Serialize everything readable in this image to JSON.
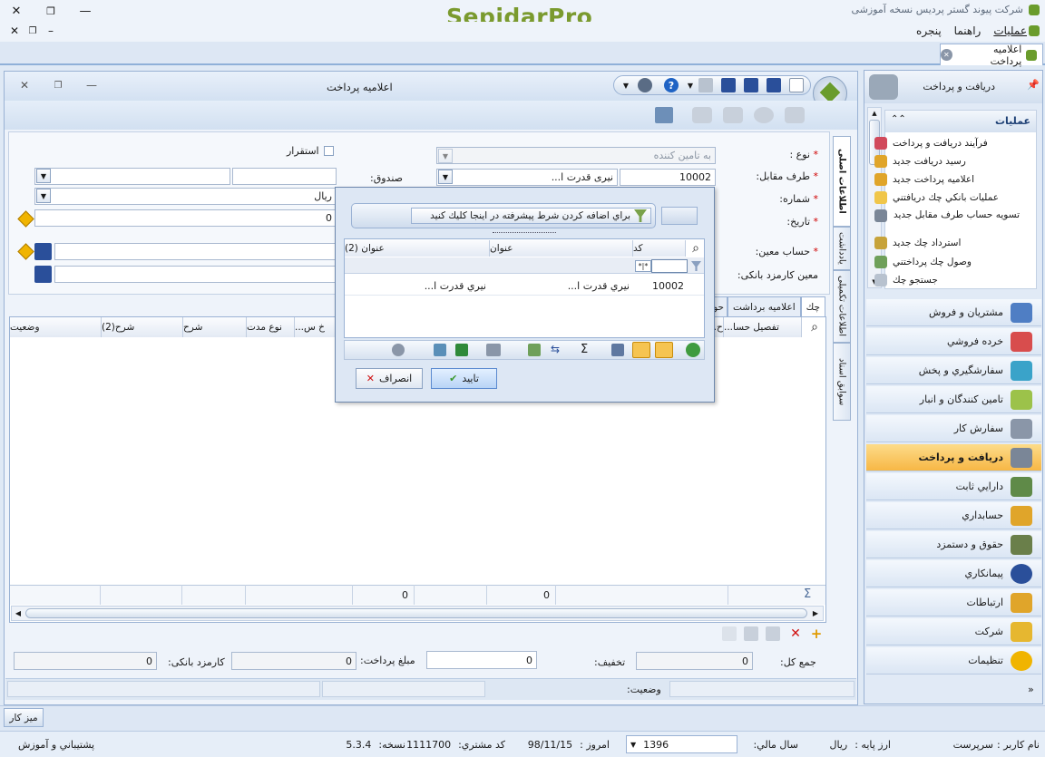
{
  "app": {
    "logo_text": "SepidarPro",
    "company_title": "شرکت پیوند گستر پردیس نسخه آموزشی",
    "menu": [
      "عملیات",
      "راهنما",
      "پنجره"
    ],
    "doc_tab": "اعلامیه پرداخت"
  },
  "window": {
    "title": "اعلامیه پرداخت"
  },
  "form": {
    "type_label": "نوع :",
    "type_value": "به تامین کننده",
    "party_label": "طرف مقابل:",
    "party_code": "10002",
    "party_name": "نیری قدرت ا...",
    "number_label": "شماره:",
    "date_label": "تاریخ:",
    "account_label": "حساب معین:",
    "bankfee_account_label": "معین کارمزد بانکی:",
    "fund_label": "صندوق:",
    "settle_label": "استقرار",
    "currency_value": "ریال",
    "amount_value": "0"
  },
  "tabs": [
    "چك",
    "اعلامیه برداشت",
    "حواله"
  ],
  "vtabs": [
    "اطلاعات اصلی",
    "یادداشت",
    "اطلاعات تکمیلی",
    "سوابق اسناد"
  ],
  "grid": {
    "headers": [
      "تفصیل حسا...",
      "ح...",
      "خ س...",
      "نوع مدت",
      "شرح",
      "شرح(2)",
      "وضعیت"
    ],
    "sums": [
      "0",
      "0"
    ]
  },
  "footer": {
    "total_label": "جمع کل:",
    "total_value": "0",
    "discount_label": "تخفیف:",
    "payment_label": "مبلغ پرداخت:",
    "payment_value": "0",
    "payment_extra": "0",
    "bankfee_label": "کارمزد بانکی:",
    "bankfee_value": "0",
    "left_value": "0",
    "status_label": "وضعیت:"
  },
  "popup": {
    "filter_prompt": "براي اضافه كردن شرط پيشرفته در اينجا كليك كنيد",
    "col_code": "کد",
    "col_title": "عنوان",
    "col_title2": "عنوان (2)",
    "filter_token": "*|*",
    "row_code": "10002",
    "row_title": "نیري قدرت ا...",
    "row_title2": "نیري قدرت ا...",
    "ok_label": "تاييد",
    "cancel_label": "انصراف"
  },
  "sidebar": {
    "header": "دريافت و پرداخت",
    "ops_title": "عمليات",
    "ops": [
      "فرآيند دريافت و پرداخت",
      "رسيد دريافت جديد",
      "اعلاميه پرداخت جديد",
      "عمليات بانكي چك دريافتني",
      "تسويه حساب طرف مقابل جديد",
      "استرداد چك جديد",
      "وصول چك پرداختني",
      "جستجو چك"
    ],
    "modules": [
      "مشتريان و فروش",
      "خرده فروشي",
      "سفارشگيري و پخش",
      "تامين كنندگان و انبار",
      "سفارش كار",
      "دريافت و پرداخت",
      "دارايي ثابت",
      "حسابداري",
      "حقوق و دستمزد",
      "پيمانكاري",
      "ارتباطات",
      "شركت",
      "تنظيمات"
    ],
    "active_module": "دريافت و پرداخت"
  },
  "taskbar": {
    "desk_label": "ميز كار"
  },
  "statusbar": {
    "user_label": "نام کاربر :",
    "user_value": "سرپرست",
    "base_currency_label": "ارز پايه :",
    "base_currency_value": "ريال",
    "fiscal_year_label": "سال مالي:",
    "fiscal_year_value": "1396",
    "today_label": "امروز :",
    "today_value": "98/11/15",
    "customer_code_label": "كد مشتري:",
    "customer_code_value": "1111700",
    "version_label": "نسخه:",
    "version_value": "5.3.4",
    "support_label": "پشتيباني و آموزش"
  },
  "colors": {
    "accent": "#f7b745",
    "title_bg": "#d6e3f3",
    "logo_green": "#7a9a2e"
  }
}
